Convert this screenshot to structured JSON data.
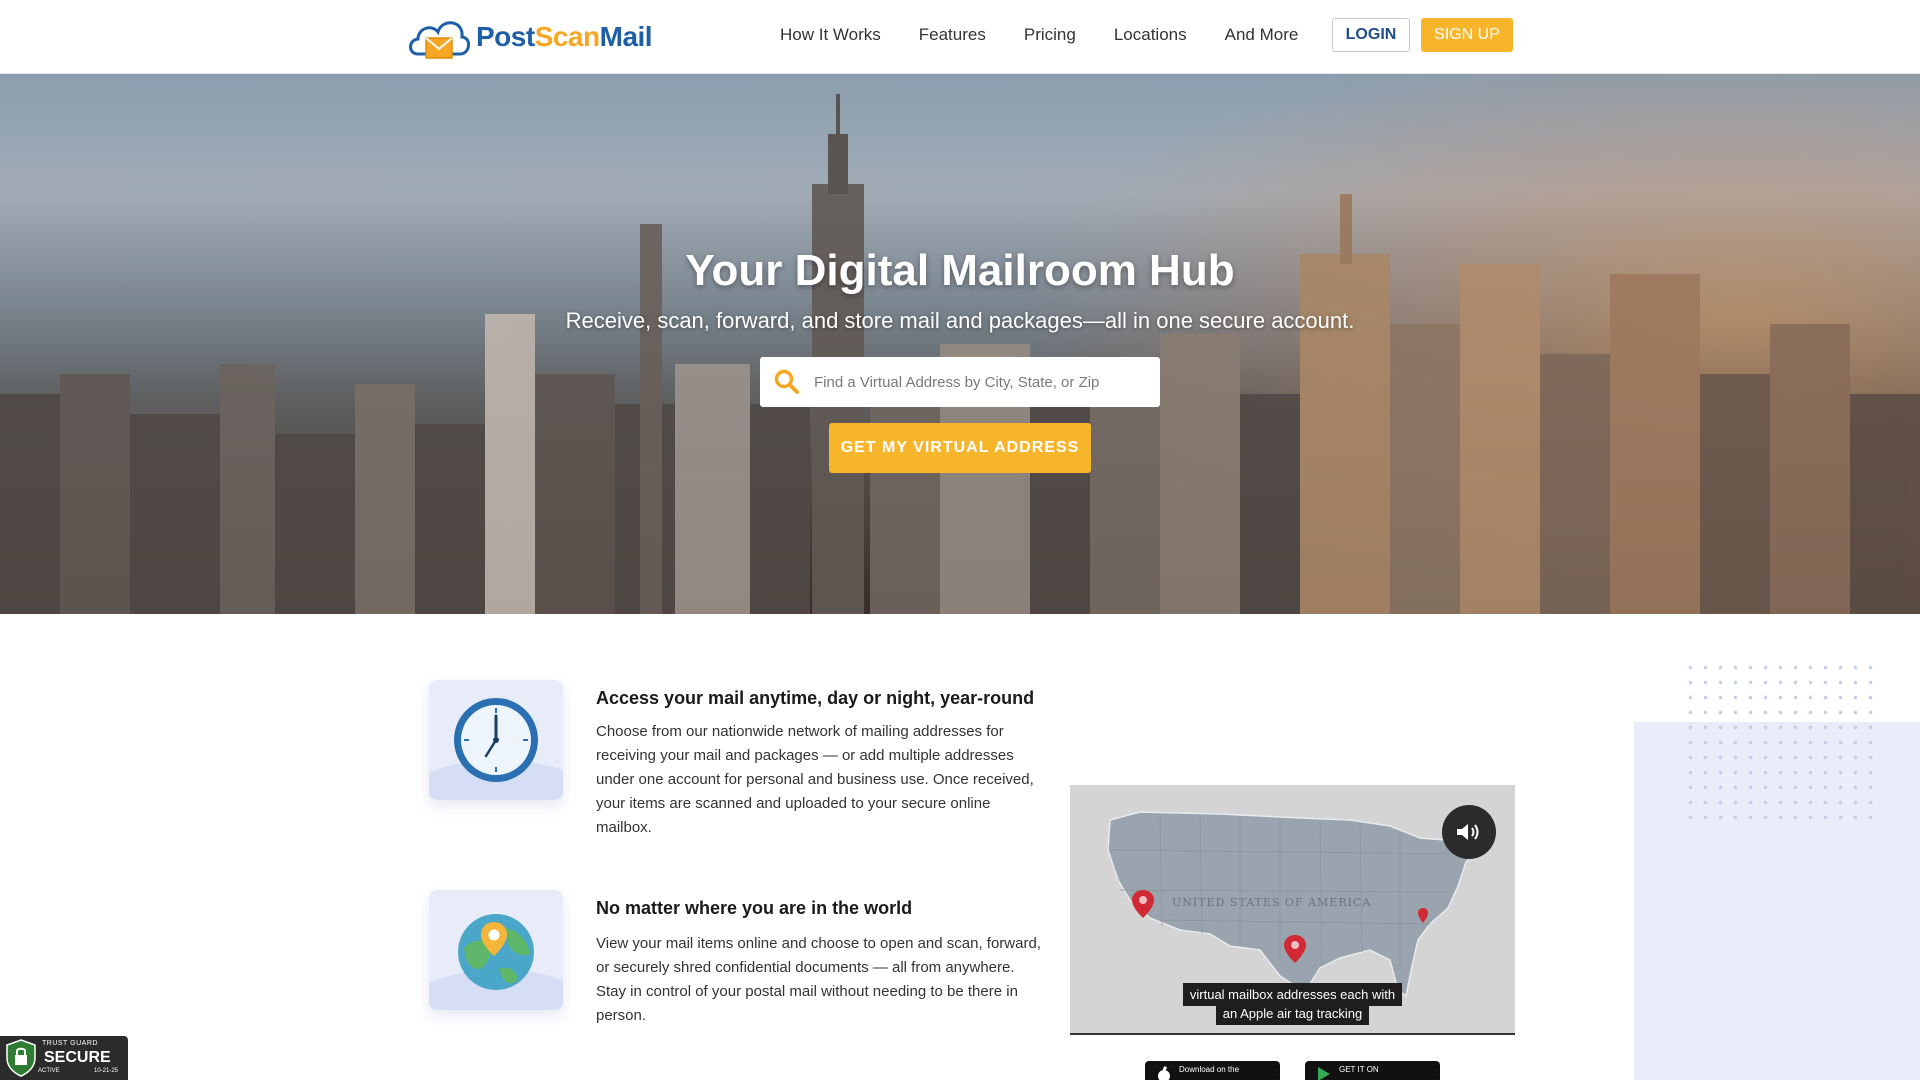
{
  "brand": {
    "part1": "Post",
    "part2": "Scan",
    "part3": "Mail",
    "colors": {
      "blue": "#1f5fa8",
      "orange": "#f5a623"
    }
  },
  "nav": {
    "items": [
      "How It Works",
      "Features",
      "Pricing",
      "Locations",
      "And More"
    ],
    "login": "LOGIN",
    "signup": "SIGN UP"
  },
  "hero": {
    "title": "Your Digital Mailroom Hub",
    "subtitle": "Receive, scan, forward, and store mail and packages—all in one secure account.",
    "search_placeholder": "Find a Virtual Address by City, State, or Zip",
    "search_icon": "search-icon",
    "cta": "GET MY VIRTUAL ADDRESS"
  },
  "features": [
    {
      "icon": "clock-icon",
      "title": "Access your mail anytime, day or night, year-round",
      "text": "Choose from our nationwide network of mailing addresses for receiving your mail and packages — or add multiple addresses under one account for personal and business use. Once received, your items are scanned and uploaded to your secure online mailbox."
    },
    {
      "icon": "globe-pin-icon",
      "title": "No matter where you are in the world",
      "text": "View your mail items online and choose to open and scan, forward, or securely shred confidential documents — all from anywhere. Stay in control of your postal mail without needing to be there in person."
    }
  ],
  "map": {
    "label": "UNITED STATES OF AMERICA",
    "caption_line1": "virtual mailbox addresses each with",
    "caption_line2": "an Apple air tag tracking"
  },
  "badges": {
    "apple": "Download on the",
    "google": "GET IT ON"
  },
  "trust": {
    "line1": "TRUST GUARD",
    "line2": "SECURE",
    "line3": "ACTIVE",
    "date": "10-21-25"
  }
}
